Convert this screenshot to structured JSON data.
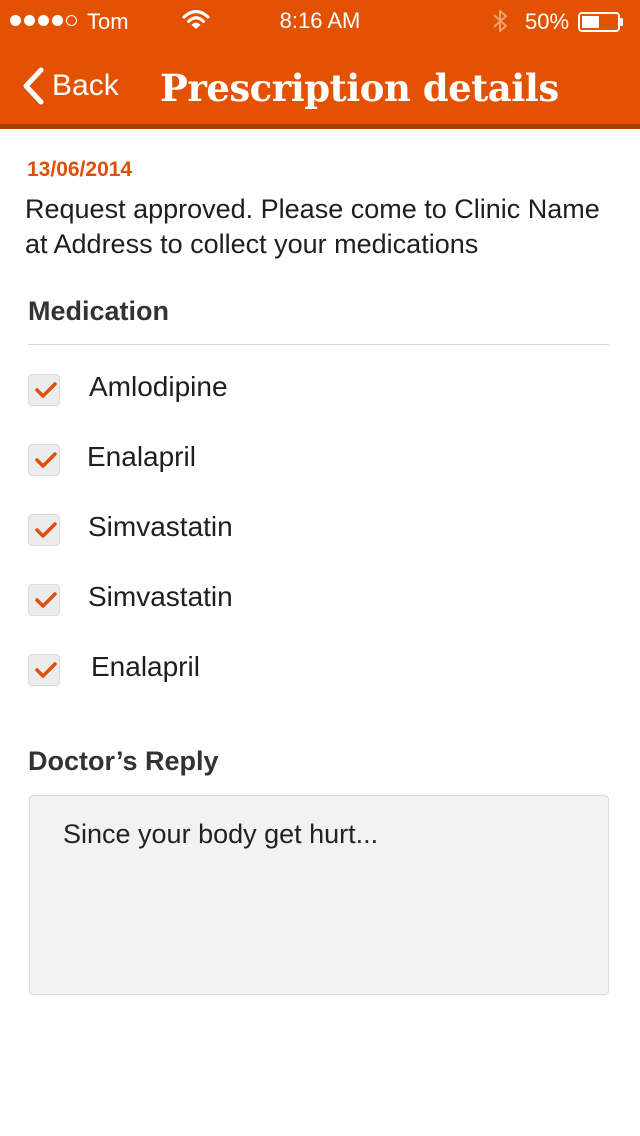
{
  "status_bar": {
    "signal_dots": 5,
    "signal_filled": 4,
    "carrier": "Tom",
    "time": "8:16 AM",
    "battery_percent": "50%",
    "battery_level": 0.5,
    "icons": [
      "wifi-icon",
      "bluetooth-icon",
      "battery-icon"
    ]
  },
  "nav": {
    "back_label": "Back",
    "back_icon": "chevron-left-icon",
    "title": "Prescription details"
  },
  "request": {
    "date": "13/06/2014",
    "message": "Request approved. Please come to Clinic Name at Address to collect your medications"
  },
  "medication": {
    "heading": "Medication",
    "items": [
      {
        "name": "Amlodipine",
        "checked": true
      },
      {
        "name": "Enalapril",
        "checked": true
      },
      {
        "name": "Simvastatin",
        "checked": true
      },
      {
        "name": "Simvastatin",
        "checked": true
      },
      {
        "name": "Enalapril",
        "checked": true
      }
    ]
  },
  "doctor_reply": {
    "heading": "Doctor’s Reply",
    "text": "Since your body get hurt..."
  },
  "colors": {
    "brand_orange": "#e35203",
    "nav_shadow": "#a63d04",
    "date_orange": "#e04e0b",
    "check_orange": "#e04e0b"
  }
}
